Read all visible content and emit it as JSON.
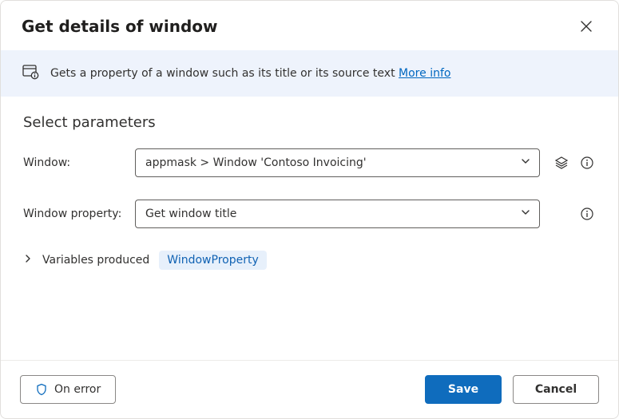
{
  "dialog": {
    "title": "Get details of window",
    "info": {
      "desc_prefix": "Gets a property of a window such as its title or its source text ",
      "more_link": "More info"
    },
    "section_title": "Select parameters",
    "rows": {
      "window": {
        "label": "Window:",
        "value": "appmask > Window 'Contoso Invoicing'"
      },
      "property": {
        "label": "Window property:",
        "value": "Get window title"
      }
    },
    "variables": {
      "label": "Variables produced",
      "chip": "WindowProperty"
    }
  },
  "footer": {
    "on_error": "On error",
    "save": "Save",
    "cancel": "Cancel"
  }
}
